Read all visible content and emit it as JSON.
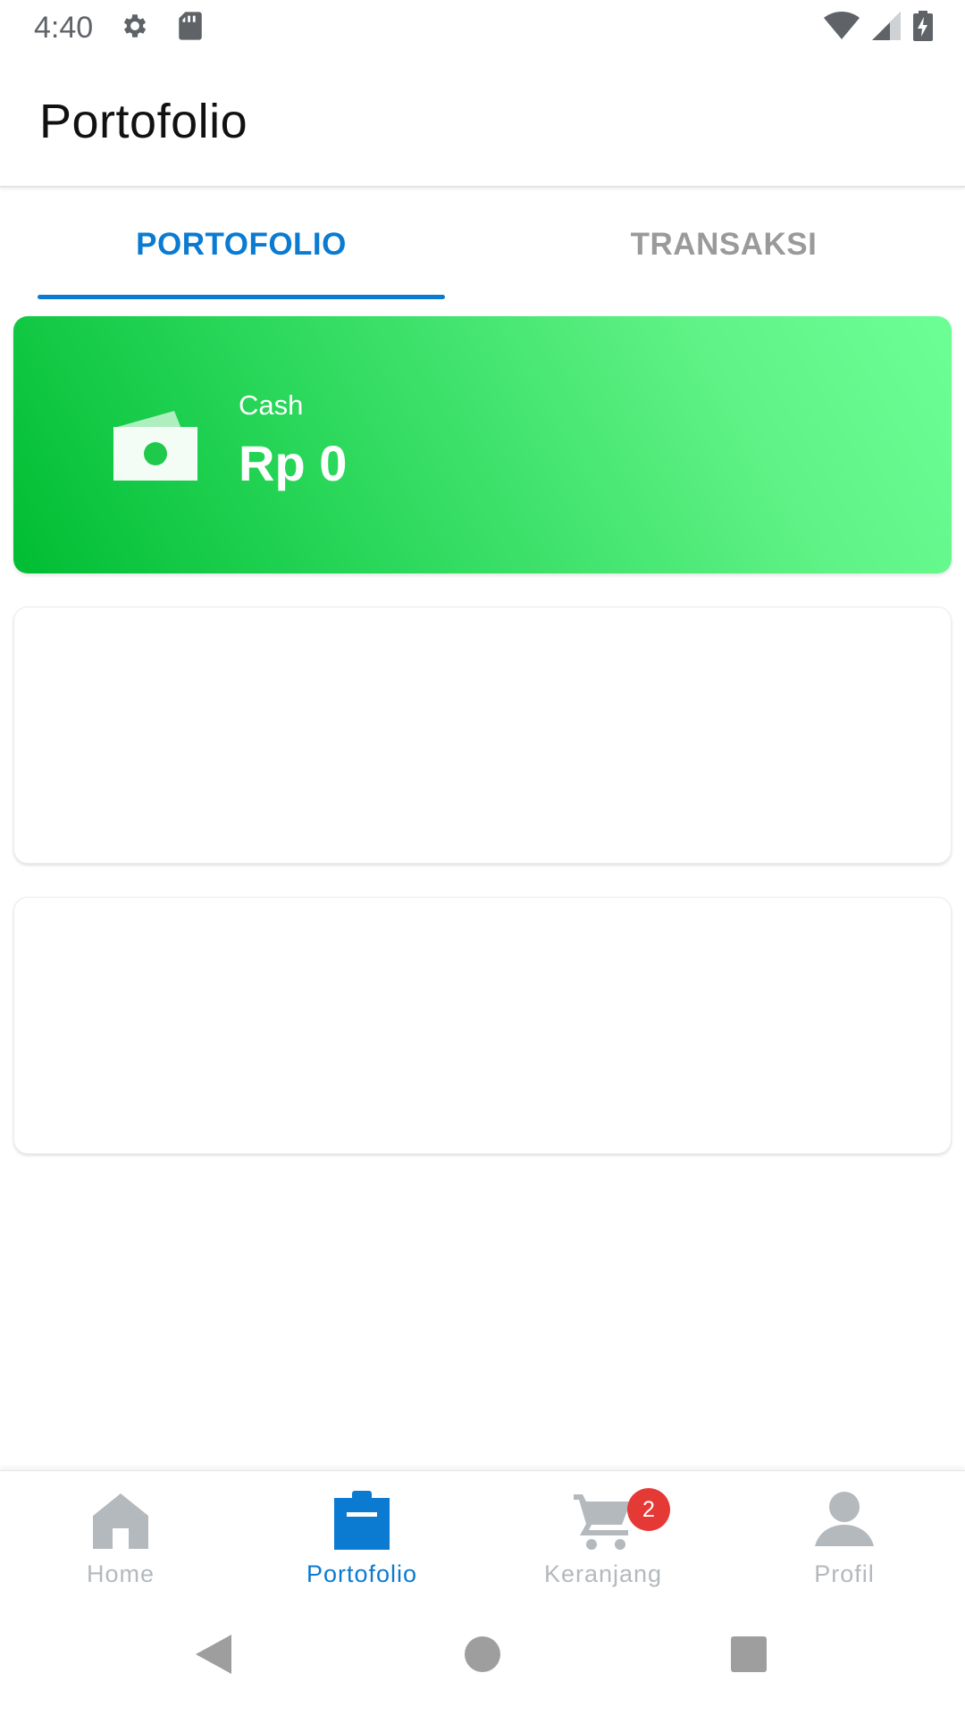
{
  "status_bar": {
    "time": "4:40",
    "icons": [
      "gear-icon",
      "sd-card-icon",
      "wifi-icon",
      "cell-signal-icon",
      "battery-charging-icon"
    ]
  },
  "app_bar": {
    "title": "Portofolio"
  },
  "tabs": [
    {
      "label": "PORTOFOLIO",
      "active": true
    },
    {
      "label": "TRANSAKSI",
      "active": false
    }
  ],
  "cash_card": {
    "label": "Cash",
    "amount": "Rp 0",
    "icon": "cash-wallet-icon"
  },
  "bottom_nav": {
    "items": [
      {
        "label": "Home",
        "icon": "home-icon",
        "active": false
      },
      {
        "label": "Portofolio",
        "icon": "clipboard-icon",
        "active": true
      },
      {
        "label": "Keranjang",
        "icon": "cart-icon",
        "active": false
      },
      {
        "label": "Profil",
        "icon": "person-icon",
        "active": false
      }
    ],
    "cart_badge": "2"
  },
  "colors": {
    "accent": "#0a7bd1",
    "inactive": "#b4b9bd",
    "card_green_start": "#00bd33",
    "card_green_end": "#6cff96",
    "badge": "#e53935"
  }
}
